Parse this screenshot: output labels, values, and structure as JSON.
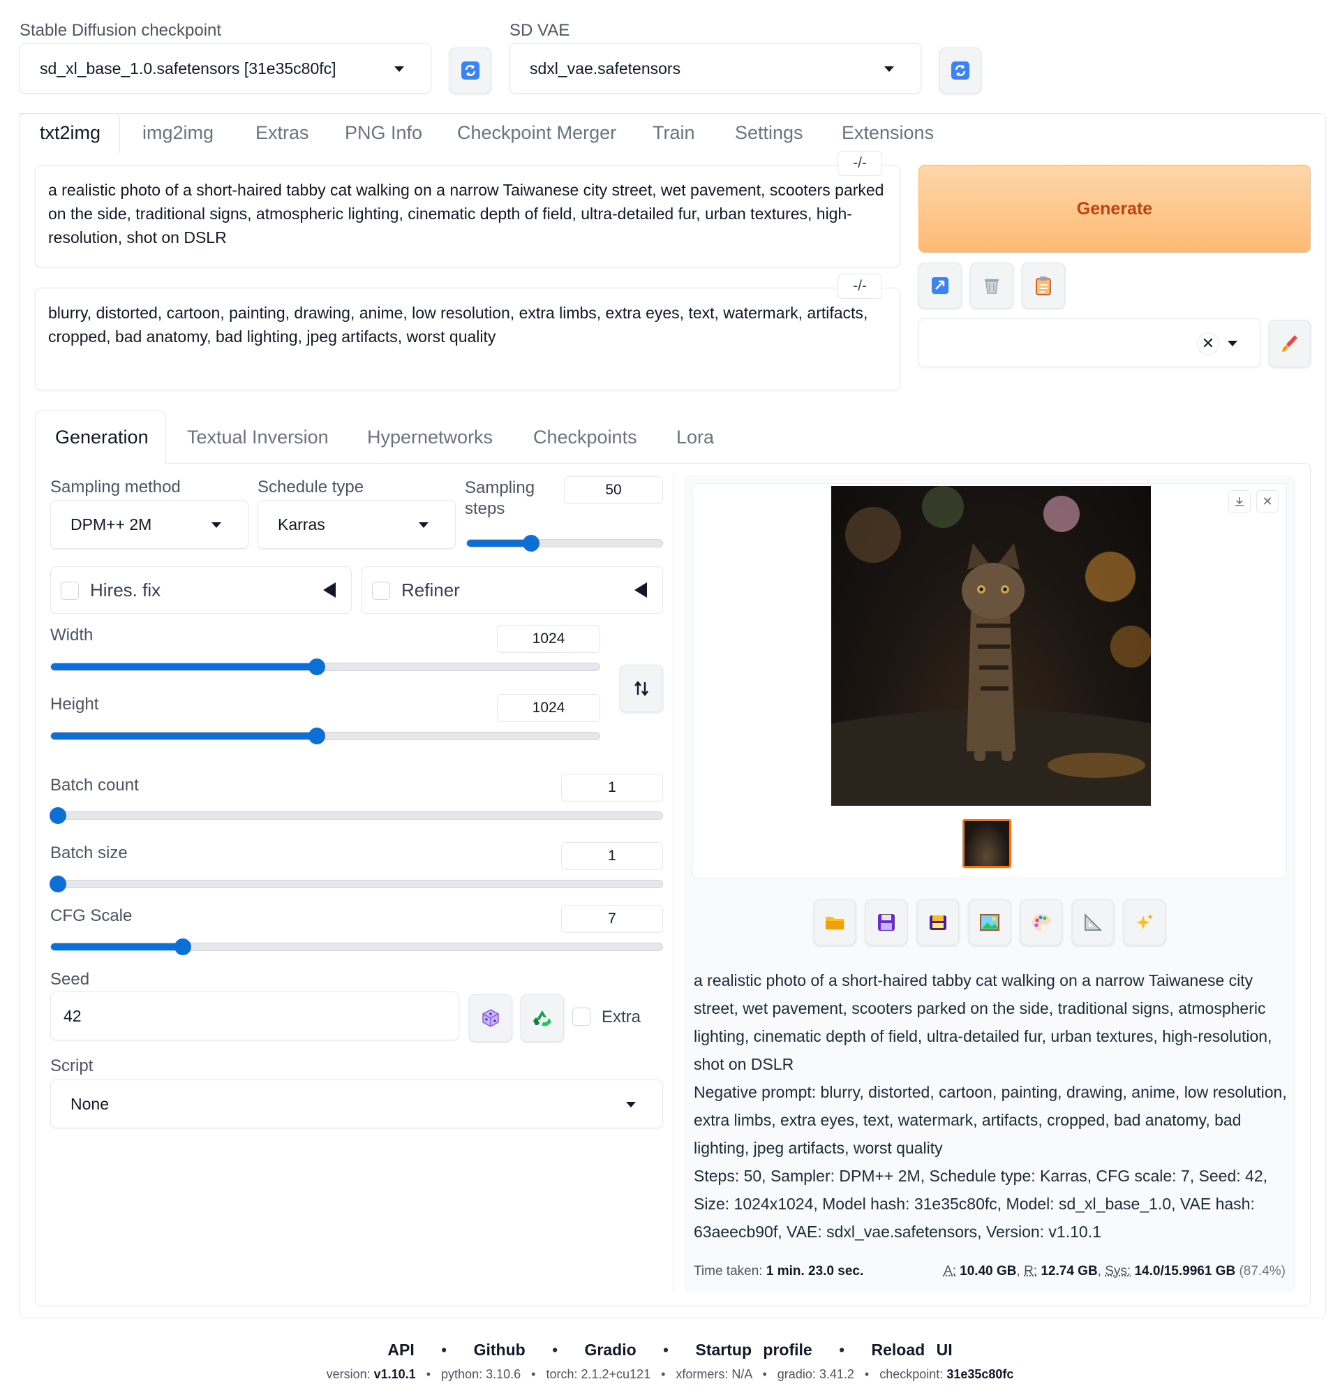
{
  "top": {
    "checkpoint_label": "Stable Diffusion checkpoint",
    "checkpoint_value": "sd_xl_base_1.0.safetensors [31e35c80fc]",
    "vae_label": "SD VAE",
    "vae_value": "sdxl_vae.safetensors"
  },
  "tabs": [
    "txt2img",
    "img2img",
    "Extras",
    "PNG Info",
    "Checkpoint Merger",
    "Train",
    "Settings",
    "Extensions"
  ],
  "prompt": {
    "positive": "a realistic photo of a short-haired tabby cat walking on a narrow Taiwanese city street, wet pavement, scooters parked on the side, traditional signs, atmospheric lighting, cinematic depth of field, ultra-detailed fur, urban textures, high-resolution, shot on DSLR",
    "negative": "blurry, distorted, cartoon, painting, drawing, anime, low resolution, extra limbs, extra eyes, text, watermark, artifacts, cropped, bad anatomy, bad lighting, jpeg artifacts, worst quality",
    "token_btn": "-/-"
  },
  "generate_label": "Generate",
  "subtabs": [
    "Generation",
    "Textual Inversion",
    "Hypernetworks",
    "Checkpoints",
    "Lora"
  ],
  "params": {
    "sampling_method_label": "Sampling method",
    "sampling_method": "DPM++ 2M",
    "schedule_type_label": "Schedule type",
    "schedule_type": "Karras",
    "sampling_steps_label": "Sampling steps",
    "sampling_steps": "50",
    "sampling_steps_fraction": 0.327,
    "hires_label": "Hires. fix",
    "refiner_label": "Refiner",
    "width_label": "Width",
    "width": "1024",
    "width_fraction": 0.485,
    "height_label": "Height",
    "height": "1024",
    "height_fraction": 0.485,
    "batch_count_label": "Batch count",
    "batch_count": "1",
    "batch_count_fraction": 0.0,
    "batch_size_label": "Batch size",
    "batch_size": "1",
    "batch_size_fraction": 0.0,
    "cfg_label": "CFG Scale",
    "cfg": "7",
    "cfg_fraction": 0.216,
    "seed_label": "Seed",
    "seed": "42",
    "extra_label": "Extra",
    "script_label": "Script",
    "script_value": "None"
  },
  "output": {
    "info_prompt": "a realistic photo of a short-haired tabby cat walking on a narrow Taiwanese city street, wet pavement, scooters parked on the side, traditional signs, atmospheric lighting, cinematic depth of field, ultra-detailed fur, urban textures, high-resolution, shot on DSLR",
    "info_negative": "Negative prompt: blurry, distorted, cartoon, painting, drawing, anime, low resolution, extra limbs, extra eyes, text, watermark, artifacts, cropped, bad anatomy, bad lighting, jpeg artifacts, worst quality",
    "info_params": "Steps: 50, Sampler: DPM++ 2M, Schedule type: Karras, CFG scale: 7, Seed: 42, Size: 1024x1024, Model hash: 31e35c80fc, Model: sd_xl_base_1.0, VAE hash: 63aeecb90f, VAE: sdxl_vae.safetensors, Version: v1.10.1",
    "time_label": "Time taken:",
    "time_value": "1 min. 23.0 sec.",
    "mem_a_label": "A:",
    "mem_a": "10.40 GB",
    "mem_r_label": "R:",
    "mem_r": "12.74 GB",
    "mem_sys_label": "Sys:",
    "mem_sys": "14.0/15.9961 GB",
    "mem_pct": "(87.4%)"
  },
  "footer": {
    "links": [
      "API",
      "Github",
      "Gradio",
      "Startup profile",
      "Reload UI"
    ],
    "sep": "•",
    "version_label": "version:",
    "version": "v1.10.1",
    "python": "python: 3.10.6",
    "torch": "torch: 2.1.2+cu121",
    "xformers": "xformers: N/A",
    "gradio": "gradio: 3.41.2",
    "checkpoint_label": "checkpoint:",
    "checkpoint": "31e35c80fc"
  },
  "icons": {
    "refresh": "refresh-icon",
    "tools": [
      "folder-icon",
      "save-icon",
      "zip-icon",
      "image-icon",
      "palette-icon",
      "ruler-icon",
      "sparkle-icon"
    ]
  },
  "colors": {
    "accent": "#0b6fd6",
    "generate_bg": "#fdba74",
    "generate_text": "#c2410c",
    "thumb_border": "#f97316"
  }
}
